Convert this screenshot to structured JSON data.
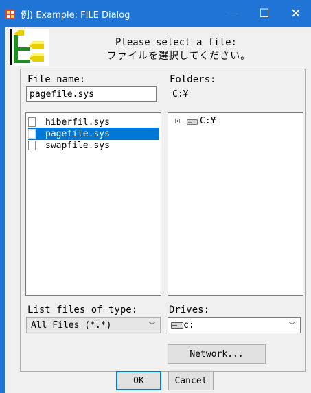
{
  "window": {
    "title": "例) Example: FILE Dialog",
    "minimize": "—",
    "maximize": "☐",
    "close": "✕"
  },
  "header": {
    "line1": "Please select a file:",
    "line2": "ファイルを選択してください。"
  },
  "file_name": {
    "label": "File name:",
    "value": "pagefile.sys"
  },
  "folders": {
    "label": "Folders:",
    "current": "C:¥",
    "tree": [
      {
        "label": "C:¥"
      }
    ]
  },
  "files": [
    {
      "name": "hiberfil.sys",
      "selected": false
    },
    {
      "name": "pagefile.sys",
      "selected": true
    },
    {
      "name": "swapfile.sys",
      "selected": false
    }
  ],
  "file_type": {
    "label": "List files of type:",
    "selected": "All Files (*.*)"
  },
  "drives": {
    "label": "Drives:",
    "selected": "c:"
  },
  "buttons": {
    "network": "Network...",
    "ok": "OK",
    "cancel": "Cancel"
  },
  "colors": {
    "titlebar": "#1f74d6",
    "selection": "#0078d7"
  }
}
